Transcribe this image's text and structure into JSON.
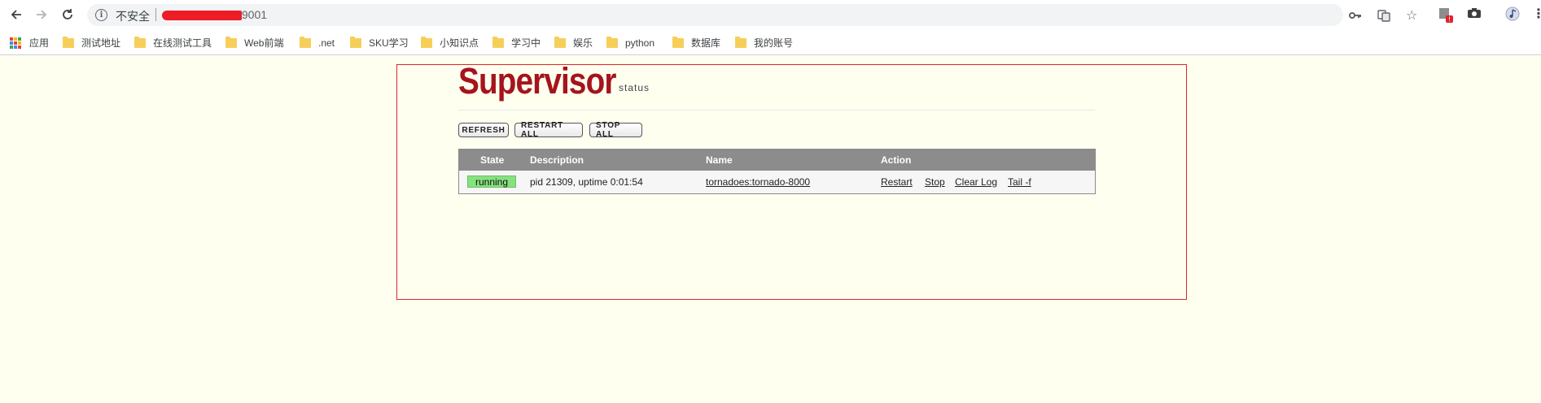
{
  "browser": {
    "security_label": "不安全",
    "url_suffix": ":9001"
  },
  "bookmarks": {
    "apps_label": "应用",
    "items": [
      "测试地址",
      "在线测试工具",
      "Web前端",
      ".net",
      "SKU学习",
      "小知识点",
      "学习中",
      "娱乐",
      "python",
      "数据库",
      "我的账号"
    ]
  },
  "supervisor": {
    "logo": "Supervisor",
    "logo_sub": "status",
    "buttons": {
      "refresh": "REFRESH",
      "restart_all": "RESTART ALL",
      "stop_all": "STOP ALL"
    },
    "table": {
      "headers": {
        "state": "State",
        "description": "Description",
        "name": "Name",
        "action": "Action"
      },
      "rows": [
        {
          "state": "running",
          "description": "pid 21309, uptime 0:01:54",
          "name": "tornadoes:tornado-8000",
          "actions": {
            "restart": "Restart",
            "stop": "Stop",
            "clear_log": "Clear Log",
            "tail": "Tail -f"
          }
        }
      ]
    }
  },
  "colors": {
    "page_bg": "#fffff0",
    "logo": "#a5141c",
    "running": "#86e27f",
    "frame": "#e0232d"
  }
}
